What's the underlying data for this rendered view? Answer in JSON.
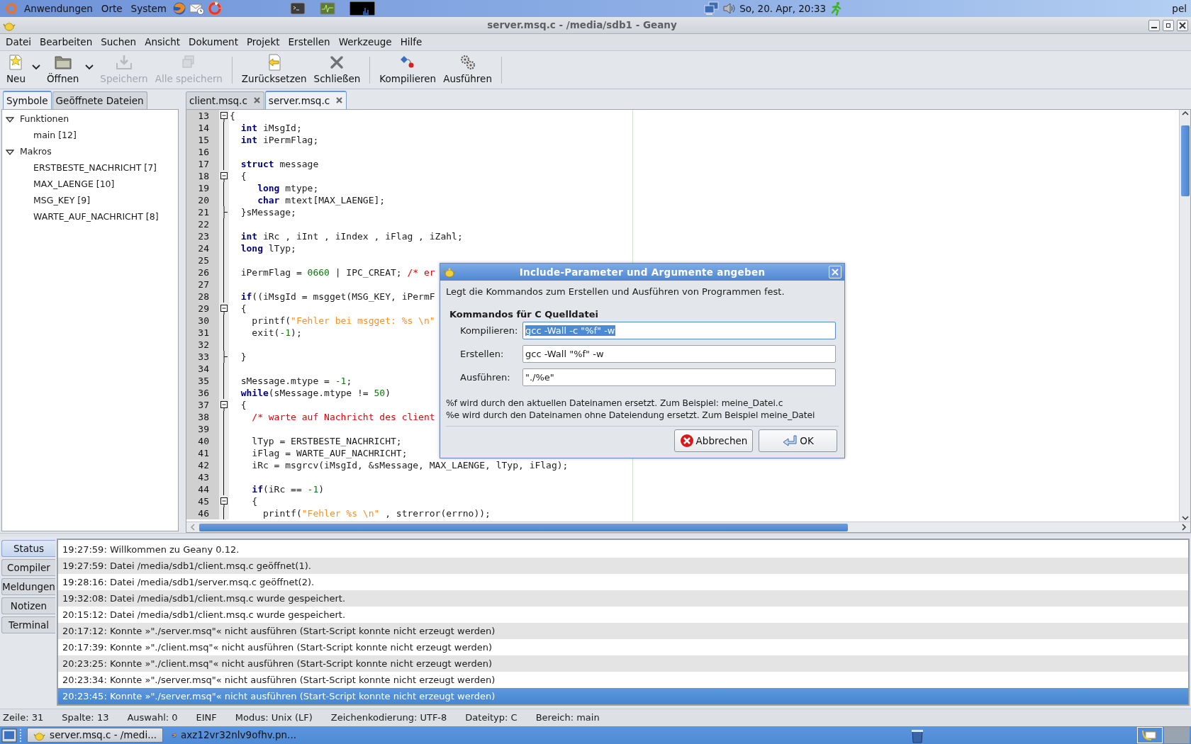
{
  "top_panel": {
    "menus": [
      "Anwendungen",
      "Orte",
      "System"
    ],
    "clock": "So, 20. Apr, 20:33",
    "user": "pel"
  },
  "window": {
    "title": "server.msq.c - /media/sdb1 - Geany"
  },
  "menu": [
    {
      "label": "Datei"
    },
    {
      "label": "Bearbeiten"
    },
    {
      "label": "Suchen"
    },
    {
      "label": "Ansicht"
    },
    {
      "label": "Dokument"
    },
    {
      "label": "Projekt"
    },
    {
      "label": "Erstellen"
    },
    {
      "label": "Werkzeuge"
    },
    {
      "label": "Hilfe"
    }
  ],
  "toolbar": [
    {
      "kind": "button",
      "label": "Neu",
      "disabled": false,
      "dropdown": true
    },
    {
      "kind": "button",
      "label": "Öffnen",
      "disabled": false,
      "dropdown": true
    },
    {
      "kind": "button",
      "label": "Speichern",
      "disabled": true,
      "dropdown": false
    },
    {
      "kind": "button",
      "label": "Alle speichern",
      "disabled": true,
      "dropdown": false
    },
    {
      "kind": "separator"
    },
    {
      "kind": "button",
      "label": "Zurücksetzen",
      "disabled": false,
      "dropdown": false
    },
    {
      "kind": "button",
      "label": "Schließen",
      "disabled": false,
      "dropdown": false
    },
    {
      "kind": "separator"
    },
    {
      "kind": "button",
      "label": "Kompilieren",
      "disabled": false,
      "dropdown": false
    },
    {
      "kind": "button",
      "label": "Ausführen",
      "disabled": false,
      "dropdown": false
    },
    {
      "kind": "separator"
    }
  ],
  "sidebar": {
    "tabs": [
      {
        "label": "Symbole",
        "selected": true
      },
      {
        "label": "Geöffnete Dateien",
        "selected": false
      }
    ],
    "tree": [
      {
        "label": "Funktionen",
        "expanded": true,
        "children": [
          {
            "label": "main [12]"
          }
        ]
      },
      {
        "label": "Makros",
        "expanded": true,
        "children": [
          {
            "label": "ERSTBESTE_NACHRICHT [7]"
          },
          {
            "label": "MAX_LAENGE [10]"
          },
          {
            "label": "MSG_KEY [9]"
          },
          {
            "label": "WARTE_AUF_NACHRICHT [8]"
          }
        ]
      }
    ]
  },
  "editor": {
    "tabs": [
      {
        "label": "client.msq.c",
        "selected": false
      },
      {
        "label": "server.msq.c",
        "selected": true
      }
    ],
    "lines": [
      {
        "num": "13",
        "kind": "fold_start",
        "tokens": [
          {
            "kind": "plain",
            "text": "{"
          }
        ]
      },
      {
        "num": "14",
        "tokens": [
          {
            "kind": "kw",
            "text": "  int"
          },
          {
            "kind": "plain",
            "text": " iMsgId;"
          }
        ]
      },
      {
        "num": "15",
        "tokens": [
          {
            "kind": "kw",
            "text": "  int"
          },
          {
            "kind": "plain",
            "text": " iPermFlag;"
          }
        ]
      },
      {
        "num": "16"
      },
      {
        "num": "17",
        "tokens": [
          {
            "kind": "kw",
            "text": "  struct"
          },
          {
            "kind": "plain",
            "text": " message"
          }
        ]
      },
      {
        "num": "18",
        "kind": "fold_start",
        "tokens": [
          {
            "kind": "plain",
            "text": "  {"
          }
        ]
      },
      {
        "num": "19",
        "tokens": [
          {
            "kind": "kw",
            "text": "     long"
          },
          {
            "kind": "plain",
            "text": " mtype;"
          }
        ]
      },
      {
        "num": "20",
        "tokens": [
          {
            "kind": "kw",
            "text": "     char"
          },
          {
            "kind": "plain",
            "text": " mtext[MAX_LAENGE];"
          }
        ]
      },
      {
        "num": "21",
        "kind": "fold_end",
        "tokens": [
          {
            "kind": "plain",
            "text": "  }sMessage;"
          }
        ]
      },
      {
        "num": "22"
      },
      {
        "num": "23",
        "tokens": [
          {
            "kind": "kw",
            "text": "  int"
          },
          {
            "kind": "plain",
            "text": " iRc , iInt , iIndex , iFlag , iZahl;"
          }
        ]
      },
      {
        "num": "24",
        "tokens": [
          {
            "kind": "kw",
            "text": "  long"
          },
          {
            "kind": "plain",
            "text": " lTyp;"
          }
        ]
      },
      {
        "num": "25"
      },
      {
        "num": "26",
        "tokens": [
          {
            "kind": "plain",
            "text": "  iPermFlag = "
          },
          {
            "kind": "num",
            "text": "0660"
          },
          {
            "kind": "plain",
            "text": " | IPC_CREAT; "
          },
          {
            "kind": "cmt",
            "text": "/* er"
          }
        ]
      },
      {
        "num": "27"
      },
      {
        "num": "28",
        "tokens": [
          {
            "kind": "kw",
            "text": "  if"
          },
          {
            "kind": "plain",
            "text": "((iMsgId = msgget(MSG_KEY, iPermF"
          }
        ]
      },
      {
        "num": "29",
        "kind": "fold_start",
        "tokens": [
          {
            "kind": "plain",
            "text": "  {"
          }
        ]
      },
      {
        "num": "30",
        "tokens": [
          {
            "kind": "plain",
            "text": "    printf("
          },
          {
            "kind": "str",
            "text": "\"Fehler bei msgget: %s \\n\""
          }
        ]
      },
      {
        "num": "31",
        "tokens": [
          {
            "kind": "plain",
            "text": "    exit("
          },
          {
            "kind": "num",
            "text": "-1"
          },
          {
            "kind": "plain",
            "text": ");"
          }
        ]
      },
      {
        "num": "32"
      },
      {
        "num": "33",
        "kind": "fold_end",
        "tokens": [
          {
            "kind": "plain",
            "text": "  }"
          }
        ]
      },
      {
        "num": "34"
      },
      {
        "num": "35",
        "tokens": [
          {
            "kind": "plain",
            "text": "  sMessage.mtype = "
          },
          {
            "kind": "num",
            "text": "-1"
          },
          {
            "kind": "plain",
            "text": ";"
          }
        ]
      },
      {
        "num": "36",
        "tokens": [
          {
            "kind": "kw",
            "text": "  while"
          },
          {
            "kind": "plain",
            "text": "(sMessage.mtype != "
          },
          {
            "kind": "num",
            "text": "50"
          },
          {
            "kind": "plain",
            "text": ")"
          }
        ]
      },
      {
        "num": "37",
        "kind": "fold_start",
        "tokens": [
          {
            "kind": "plain",
            "text": "  {"
          }
        ]
      },
      {
        "num": "38",
        "tokens": [
          {
            "kind": "cmt",
            "text": "    /* warte auf Nachricht des client"
          }
        ]
      },
      {
        "num": "39"
      },
      {
        "num": "40",
        "tokens": [
          {
            "kind": "plain",
            "text": "    lTyp = ERSTBESTE_NACHRICHT;"
          }
        ]
      },
      {
        "num": "41",
        "tokens": [
          {
            "kind": "plain",
            "text": "    iFlag = WARTE_AUF_NACHRICHT;"
          }
        ]
      },
      {
        "num": "42",
        "tokens": [
          {
            "kind": "plain",
            "text": "    iRc = msgrcv(iMsgId, &sMessage, MAX_LAENGE, lTyp, iFlag);"
          }
        ]
      },
      {
        "num": "43"
      },
      {
        "num": "44",
        "tokens": [
          {
            "kind": "kw",
            "text": "    if"
          },
          {
            "kind": "plain",
            "text": "(iRc == "
          },
          {
            "kind": "num",
            "text": "-1"
          },
          {
            "kind": "plain",
            "text": ")"
          }
        ]
      },
      {
        "num": "45",
        "kind": "fold_start",
        "tokens": [
          {
            "kind": "plain",
            "text": "    {"
          }
        ]
      },
      {
        "num": "46",
        "tokens": [
          {
            "kind": "plain",
            "text": "      printf("
          },
          {
            "kind": "str",
            "text": "\"Fehler %s \\n\""
          },
          {
            "kind": "plain",
            "text": " , strerror(errno));"
          }
        ]
      }
    ]
  },
  "dialog": {
    "title": "Include-Parameter und Argumente angeben",
    "description": "Legt die Kommandos zum Erstellen und Ausführen von Programmen fest.",
    "section": "Kommandos für C Quelldatei",
    "fields": [
      {
        "label": "Kompilieren:",
        "value": "gcc -Wall -c \"%f\" -w",
        "text_selected": true
      },
      {
        "label": "Erstellen:",
        "value": "gcc -Wall \"%f\" -w",
        "text_selected": false
      },
      {
        "label": "Ausführen:",
        "value": "\"./%e\"",
        "text_selected": false
      }
    ],
    "notes": [
      "%f wird durch den aktuellen Dateinamen ersetzt. Zum Beispiel: meine_Datei.c",
      "%e wird durch den Dateinamen ohne Dateiendung ersetzt. Zum Beispiel meine_Datei"
    ],
    "buttons": [
      {
        "kind": "cancel",
        "label": "Abbrechen"
      },
      {
        "kind": "ok",
        "label": "OK"
      }
    ]
  },
  "messages": {
    "tabs": [
      {
        "label": "Status",
        "selected": true
      },
      {
        "label": "Compiler",
        "selected": false
      },
      {
        "label": "Meldungen",
        "selected": false
      },
      {
        "label": "Notizen",
        "selected": false
      },
      {
        "label": "Terminal",
        "selected": false
      }
    ],
    "rows": [
      {
        "text": "19:27:59: Willkommen zu Geany 0.12.",
        "selected": false
      },
      {
        "text": "19:27:59: Datei /media/sdb1/client.msq.c geöffnet(1).",
        "selected": false
      },
      {
        "text": "19:28:16: Datei /media/sdb1/server.msq.c geöffnet(2).",
        "selected": false
      },
      {
        "text": "19:32:08: Datei /media/sdb1/client.msq.c wurde gespeichert.",
        "selected": false
      },
      {
        "text": "20:15:12: Datei /media/sdb1/client.msq.c wurde gespeichert.",
        "selected": false
      },
      {
        "text": "20:17:12: Konnte »\"./server.msq\"« nicht ausführen (Start-Script konnte nicht erzeugt werden)",
        "selected": false
      },
      {
        "text": "20:17:39: Konnte »\"./client.msq\"« nicht ausführen (Start-Script konnte nicht erzeugt werden)",
        "selected": false
      },
      {
        "text": "20:23:25: Konnte »\"./client.msq\"« nicht ausführen (Start-Script konnte nicht erzeugt werden)",
        "selected": false
      },
      {
        "text": "20:23:34: Konnte »\"./server.msq\"« nicht ausführen (Start-Script konnte nicht erzeugt werden)",
        "selected": false
      },
      {
        "text": "20:23:45: Konnte »\"./server.msq\"« nicht ausführen (Start-Script konnte nicht erzeugt werden)",
        "selected": true
      }
    ]
  },
  "status_bar": [
    "Zeile: 31",
    "Spalte: 13",
    "Auswahl: 0",
    "EINF",
    "Modus: Unix (LF)",
    "Zeichenkodierung: UTF-8",
    "Dateityp: C",
    "Bereich: main"
  ],
  "taskbar": [
    {
      "label": "server.msq.c - /medi...",
      "selected": true
    },
    {
      "label": "axz12vr32nlv9ofhv.pn...",
      "selected": false
    }
  ]
}
